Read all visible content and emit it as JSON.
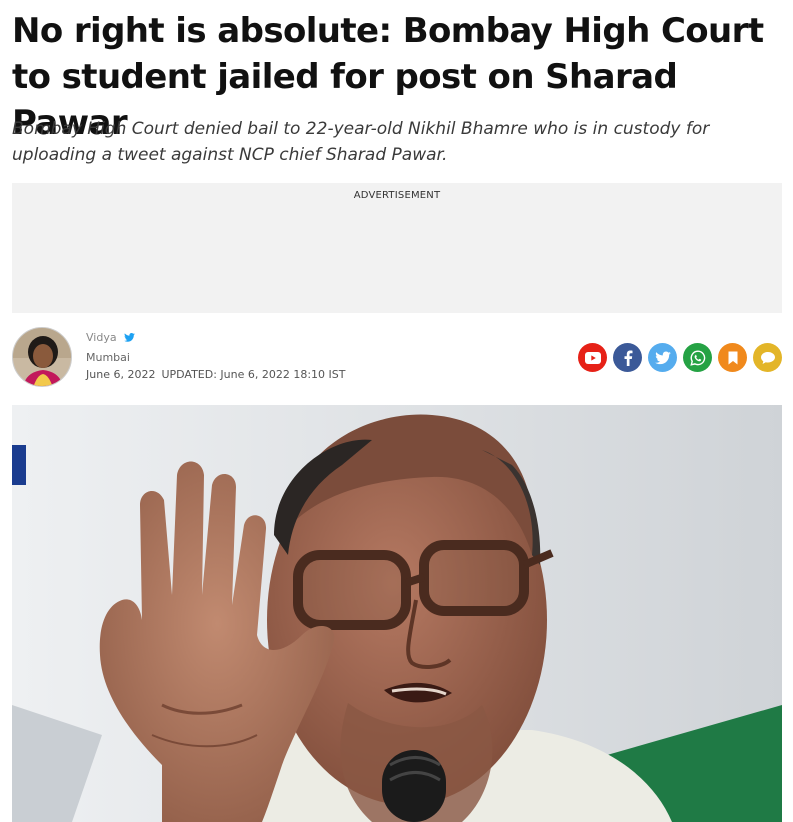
{
  "article": {
    "headline": "No right is absolute: Bombay High Court to student jailed for post on Sharad Pawar",
    "summary": "Bombay High Court denied bail to 22-year-old Nikhil Bhamre who is in custody for uploading a tweet against NCP chief Sharad Pawar."
  },
  "advertisement": {
    "label": "ADVERTISEMENT"
  },
  "byline": {
    "author": "Vidya",
    "location": "Mumbai",
    "published": "June 6, 2022",
    "updated": "UPDATED: June 6, 2022 18:10 IST"
  },
  "share": [
    {
      "name": "youtube-icon",
      "color": "#e62117"
    },
    {
      "name": "facebook-icon",
      "color": "#3b5998"
    },
    {
      "name": "twitter-icon",
      "color": "#55acee"
    },
    {
      "name": "whatsapp-icon",
      "color": "#25a244"
    },
    {
      "name": "bookmark-icon",
      "color": "#f0891c"
    },
    {
      "name": "comment-icon",
      "color": "#e3b528"
    }
  ],
  "colors": {
    "verified": "#1da1f2"
  }
}
